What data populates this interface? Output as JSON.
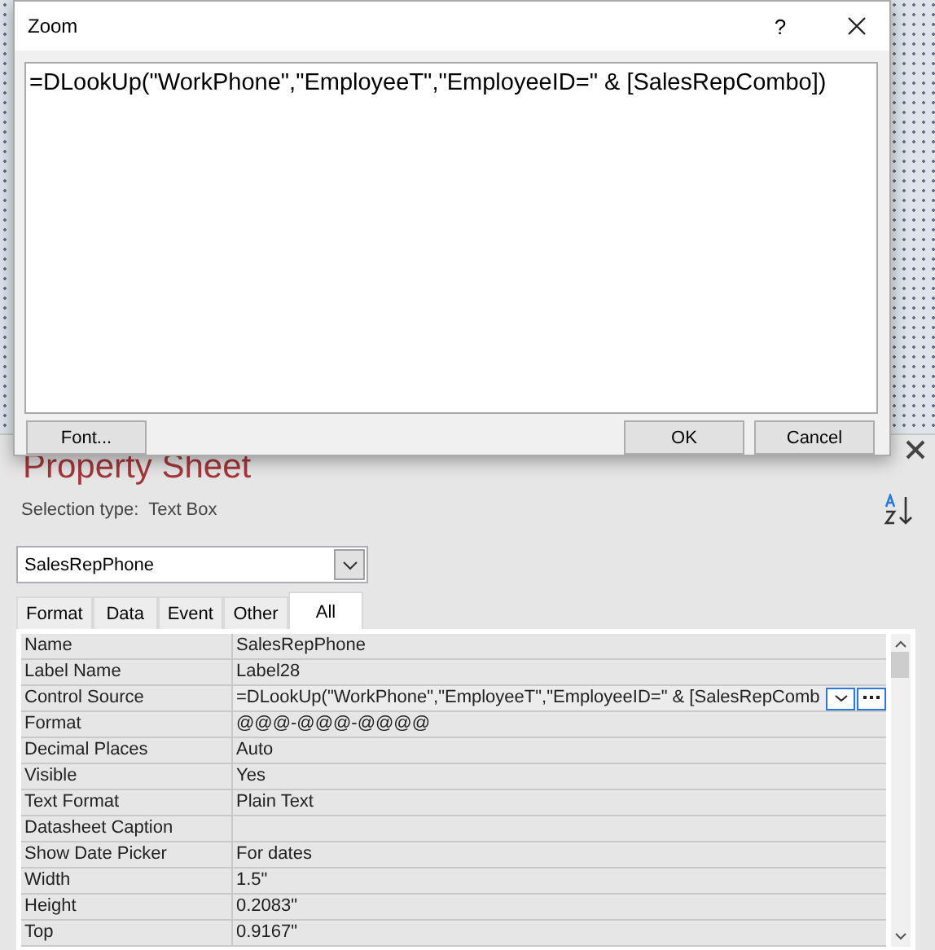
{
  "zoom_dialog": {
    "title": "Zoom",
    "help": "?",
    "text": "=DLookUp(\"WorkPhone\",\"EmployeeT\",\"EmployeeID=\" & [SalesRepCombo])",
    "buttons": [
      {
        "label": "Font...",
        "kind": "left"
      },
      {
        "label": "OK",
        "kind": "right"
      },
      {
        "label": "Cancel",
        "kind": "right"
      }
    ]
  },
  "property_sheet": {
    "title": "Property Sheet",
    "selection_label": "Selection type:",
    "selection_type": "Text Box",
    "object": "SalesRepPhone",
    "tabs": [
      {
        "label": "Format",
        "selected": false
      },
      {
        "label": "Data",
        "selected": false
      },
      {
        "label": "Event",
        "selected": false
      },
      {
        "label": "Other",
        "selected": false
      },
      {
        "label": "All",
        "selected": true
      }
    ],
    "rows": [
      {
        "name": "Name",
        "value": "SalesRepPhone",
        "focused": false
      },
      {
        "name": "Label Name",
        "value": "Label28",
        "focused": false
      },
      {
        "name": "Control Source",
        "value": "=DLookUp(\"WorkPhone\",\"EmployeeT\",\"EmployeeID=\" & [SalesRepComb",
        "focused": true
      },
      {
        "name": "Format",
        "value": "@@@-@@@-@@@@",
        "focused": false
      },
      {
        "name": "Decimal Places",
        "value": "Auto",
        "focused": false
      },
      {
        "name": "Visible",
        "value": "Yes",
        "focused": false
      },
      {
        "name": "Text Format",
        "value": "Plain Text",
        "focused": false
      },
      {
        "name": "Datasheet Caption",
        "value": "",
        "focused": false
      },
      {
        "name": "Show Date Picker",
        "value": "For dates",
        "focused": false
      },
      {
        "name": "Width",
        "value": "1.5\"",
        "focused": false
      },
      {
        "name": "Height",
        "value": "0.2083\"",
        "focused": false
      },
      {
        "name": "Top",
        "value": "0.9167\"",
        "focused": false
      }
    ]
  }
}
